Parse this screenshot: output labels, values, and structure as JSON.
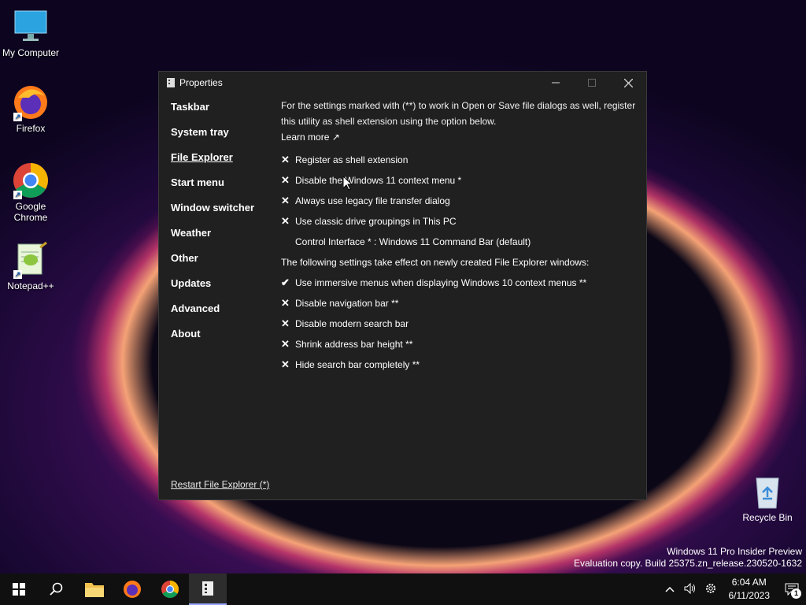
{
  "desktop": {
    "icons": [
      {
        "label": "My Computer"
      },
      {
        "label": "Firefox"
      },
      {
        "label": "Google Chrome"
      },
      {
        "label": "Notepad++"
      }
    ],
    "recycle_bin": "Recycle Bin"
  },
  "window": {
    "title": "Properties",
    "nav": [
      "Taskbar",
      "System tray",
      "File Explorer",
      "Start menu",
      "Window switcher",
      "Weather",
      "Other",
      "Updates",
      "Advanced",
      "About"
    ],
    "active_nav": "File Explorer",
    "restart_link": "Restart File Explorer (*)",
    "intro": "For the settings marked with (**) to work in Open or Save file dialogs as well, register this utility as shell extension using the option below.",
    "learn_more": "Learn more ↗",
    "options_a": [
      {
        "mark": "✕",
        "label": "Register as shell extension"
      },
      {
        "mark": "✕",
        "label": "Disable the Windows 11 context menu *"
      },
      {
        "mark": "✕",
        "label": "Always use legacy file transfer dialog"
      },
      {
        "mark": "✕",
        "label": "Use classic drive groupings in This PC"
      },
      {
        "mark": "",
        "label": "Control Interface * : Windows 11 Command Bar (default)"
      }
    ],
    "note": "The following settings take effect on newly created File Explorer windows:",
    "options_b": [
      {
        "mark": "✔",
        "label": "Use immersive menus when displaying Windows 10 context menus **"
      },
      {
        "mark": "✕",
        "label": "Disable navigation bar **"
      },
      {
        "mark": "✕",
        "label": "Disable modern search bar"
      },
      {
        "mark": "✕",
        "label": "Shrink address bar height **"
      },
      {
        "mark": "✕",
        "label": "Hide search bar completely **"
      }
    ]
  },
  "watermark": {
    "line1": "Windows 11 Pro Insider Preview",
    "line2": "Evaluation copy. Build 25375.zn_release.230520-1632"
  },
  "taskbar": {
    "time": "6:04 AM",
    "date": "6/11/2023",
    "notifications": "1"
  }
}
